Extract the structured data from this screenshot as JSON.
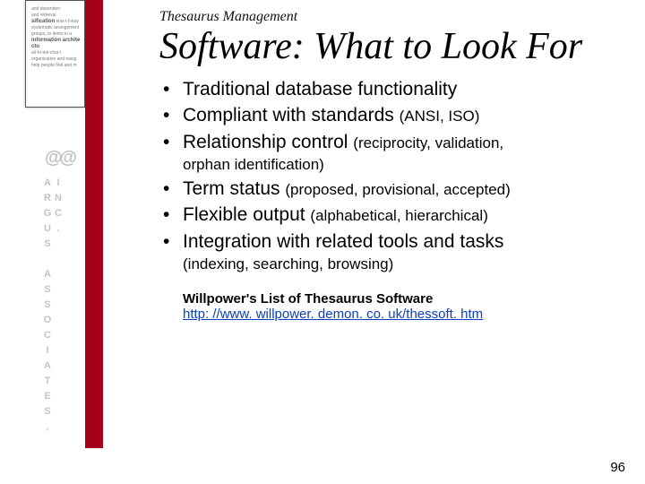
{
  "brand": {
    "at": "@@",
    "name": "ARGUS ASSOCIATES, INC."
  },
  "supertitle": "Thesaurus Management",
  "title": "Software: What to Look For",
  "bullets": [
    {
      "main": "Traditional database functionality",
      "sub": ""
    },
    {
      "main": "Compliant with standards ",
      "sub": "(ANSI, ISO)"
    },
    {
      "main": "Relationship control ",
      "sub": "(reciprocity, validation, ",
      "subline": "orphan identification)"
    },
    {
      "main": "Term status ",
      "sub": "(proposed, provisional, accepted)"
    },
    {
      "main": "Flexible output ",
      "sub": "(alphabetical, hierarchical)"
    },
    {
      "main": "Integration with related tools and tasks",
      "sub": "",
      "subline": "(indexing, searching, browsing)"
    }
  ],
  "footer": {
    "note": "Willpower's List of Thesaurus Software",
    "link": "http: //www. willpower. demon. co. uk/thessoft. htm"
  },
  "page_number": "96",
  "thumb_text": "and dependen and retrieval klas-i-fi-kay systematic arrangement of groups, to items in a alr-ki-tek-chur-i organization and navig help people find and m"
}
